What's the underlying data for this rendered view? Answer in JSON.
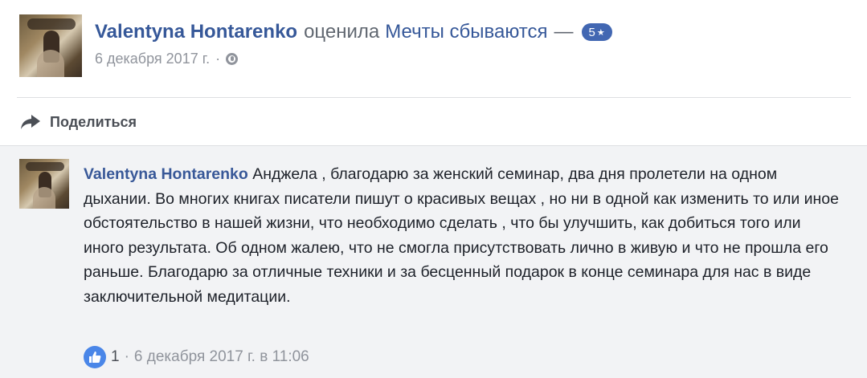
{
  "post": {
    "author": "Valentyna Hontarenko",
    "action": "оценила",
    "page_name": "Мечты сбываются",
    "dash": "—",
    "rating_value": "5",
    "rating_star": "★",
    "date": "6 декабря 2017 г.",
    "separator": "·",
    "privacy_icon": "globe-icon"
  },
  "actions": {
    "share_label": "Поделиться",
    "share_icon": "share-arrow-icon"
  },
  "comment": {
    "author": "Valentyna Hontarenko",
    "text": "Анджела , благодарю за женский семинар, два дня пролетели на одном дыхании. Во многих книгах писатели пишут о красивых вещах , но ни в одной как изменить то или иное обстоятельство в нашей жизни, что необходимо сделать , что бы улучшить, как добиться того или иного результата. Об одном жалею, что не смогла присутствовать лично в живую и что не прошла его раньше. Благодарю за отличные техники и за бесценный подарок в конце семинара для нас в виде заключительной медитации.",
    "like_icon": "thumbs-up-icon",
    "like_count": "1",
    "separator": "·",
    "timestamp": "6 декабря 2017 г. в 11:06"
  },
  "colors": {
    "link": "#365899",
    "badge": "#4267b2",
    "like": "#4a86e8",
    "muted": "#90949c",
    "comment_bg": "#f2f3f5"
  }
}
